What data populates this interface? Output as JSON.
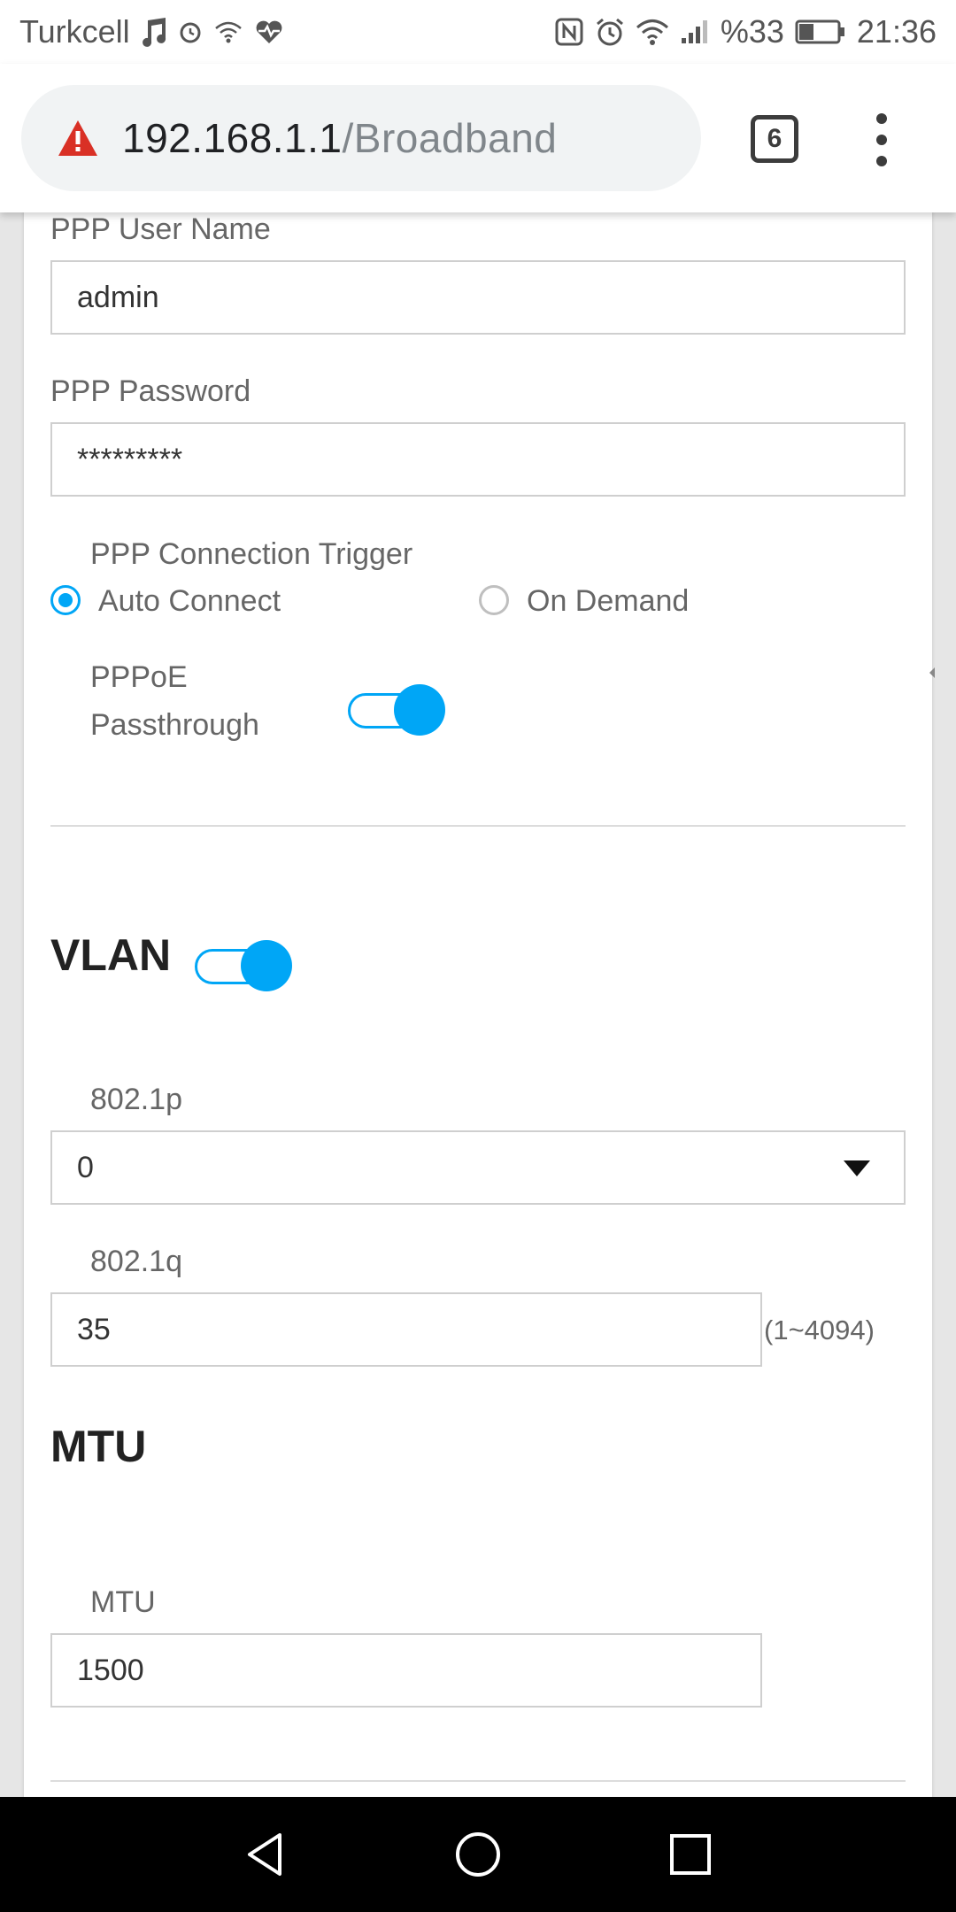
{
  "status_bar": {
    "carrier": "Turkcell",
    "battery_percent": "%33",
    "time": "21:36",
    "icons_left": [
      "music-note-icon",
      "alarm-icon",
      "wifi-hotspot-icon",
      "health-heart-icon"
    ],
    "icons_right": [
      "nfc-icon",
      "alarm-icon",
      "wifi-icon",
      "signal-icon",
      "battery-icon"
    ]
  },
  "browser": {
    "url_host": "192.168.1.1",
    "url_path": "/Broadband",
    "tab_count": "6",
    "security_icon": "warning-icon",
    "warning_color": "#d93025"
  },
  "form": {
    "ppp_user_name_label": "PPP User Name",
    "ppp_user_name_value": "admin",
    "ppp_password_label": "PPP Password",
    "ppp_password_value": "*********",
    "connection_trigger_label": "PPP Connection Trigger",
    "auto_connect_label": "Auto Connect",
    "on_demand_label": "On Demand",
    "selected_trigger": "Auto Connect",
    "pppoe_passthrough_label_line1": "PPPoE",
    "pppoe_passthrough_label_line2": "Passthrough",
    "pppoe_passthrough_on": true
  },
  "vlan": {
    "title": "VLAN",
    "enabled": true,
    "p_label": "802.1p",
    "p_value": "0",
    "q_label": "802.1q",
    "q_value": "35",
    "q_range": "(1~4094)"
  },
  "mtu": {
    "title": "MTU",
    "label": "MTU",
    "value": "1500"
  },
  "colors": {
    "accent": "#00a6f6",
    "page_background": "#e6e6e6"
  },
  "nav_bar": {
    "icons": [
      "back-icon",
      "home-icon",
      "recents-icon"
    ]
  }
}
